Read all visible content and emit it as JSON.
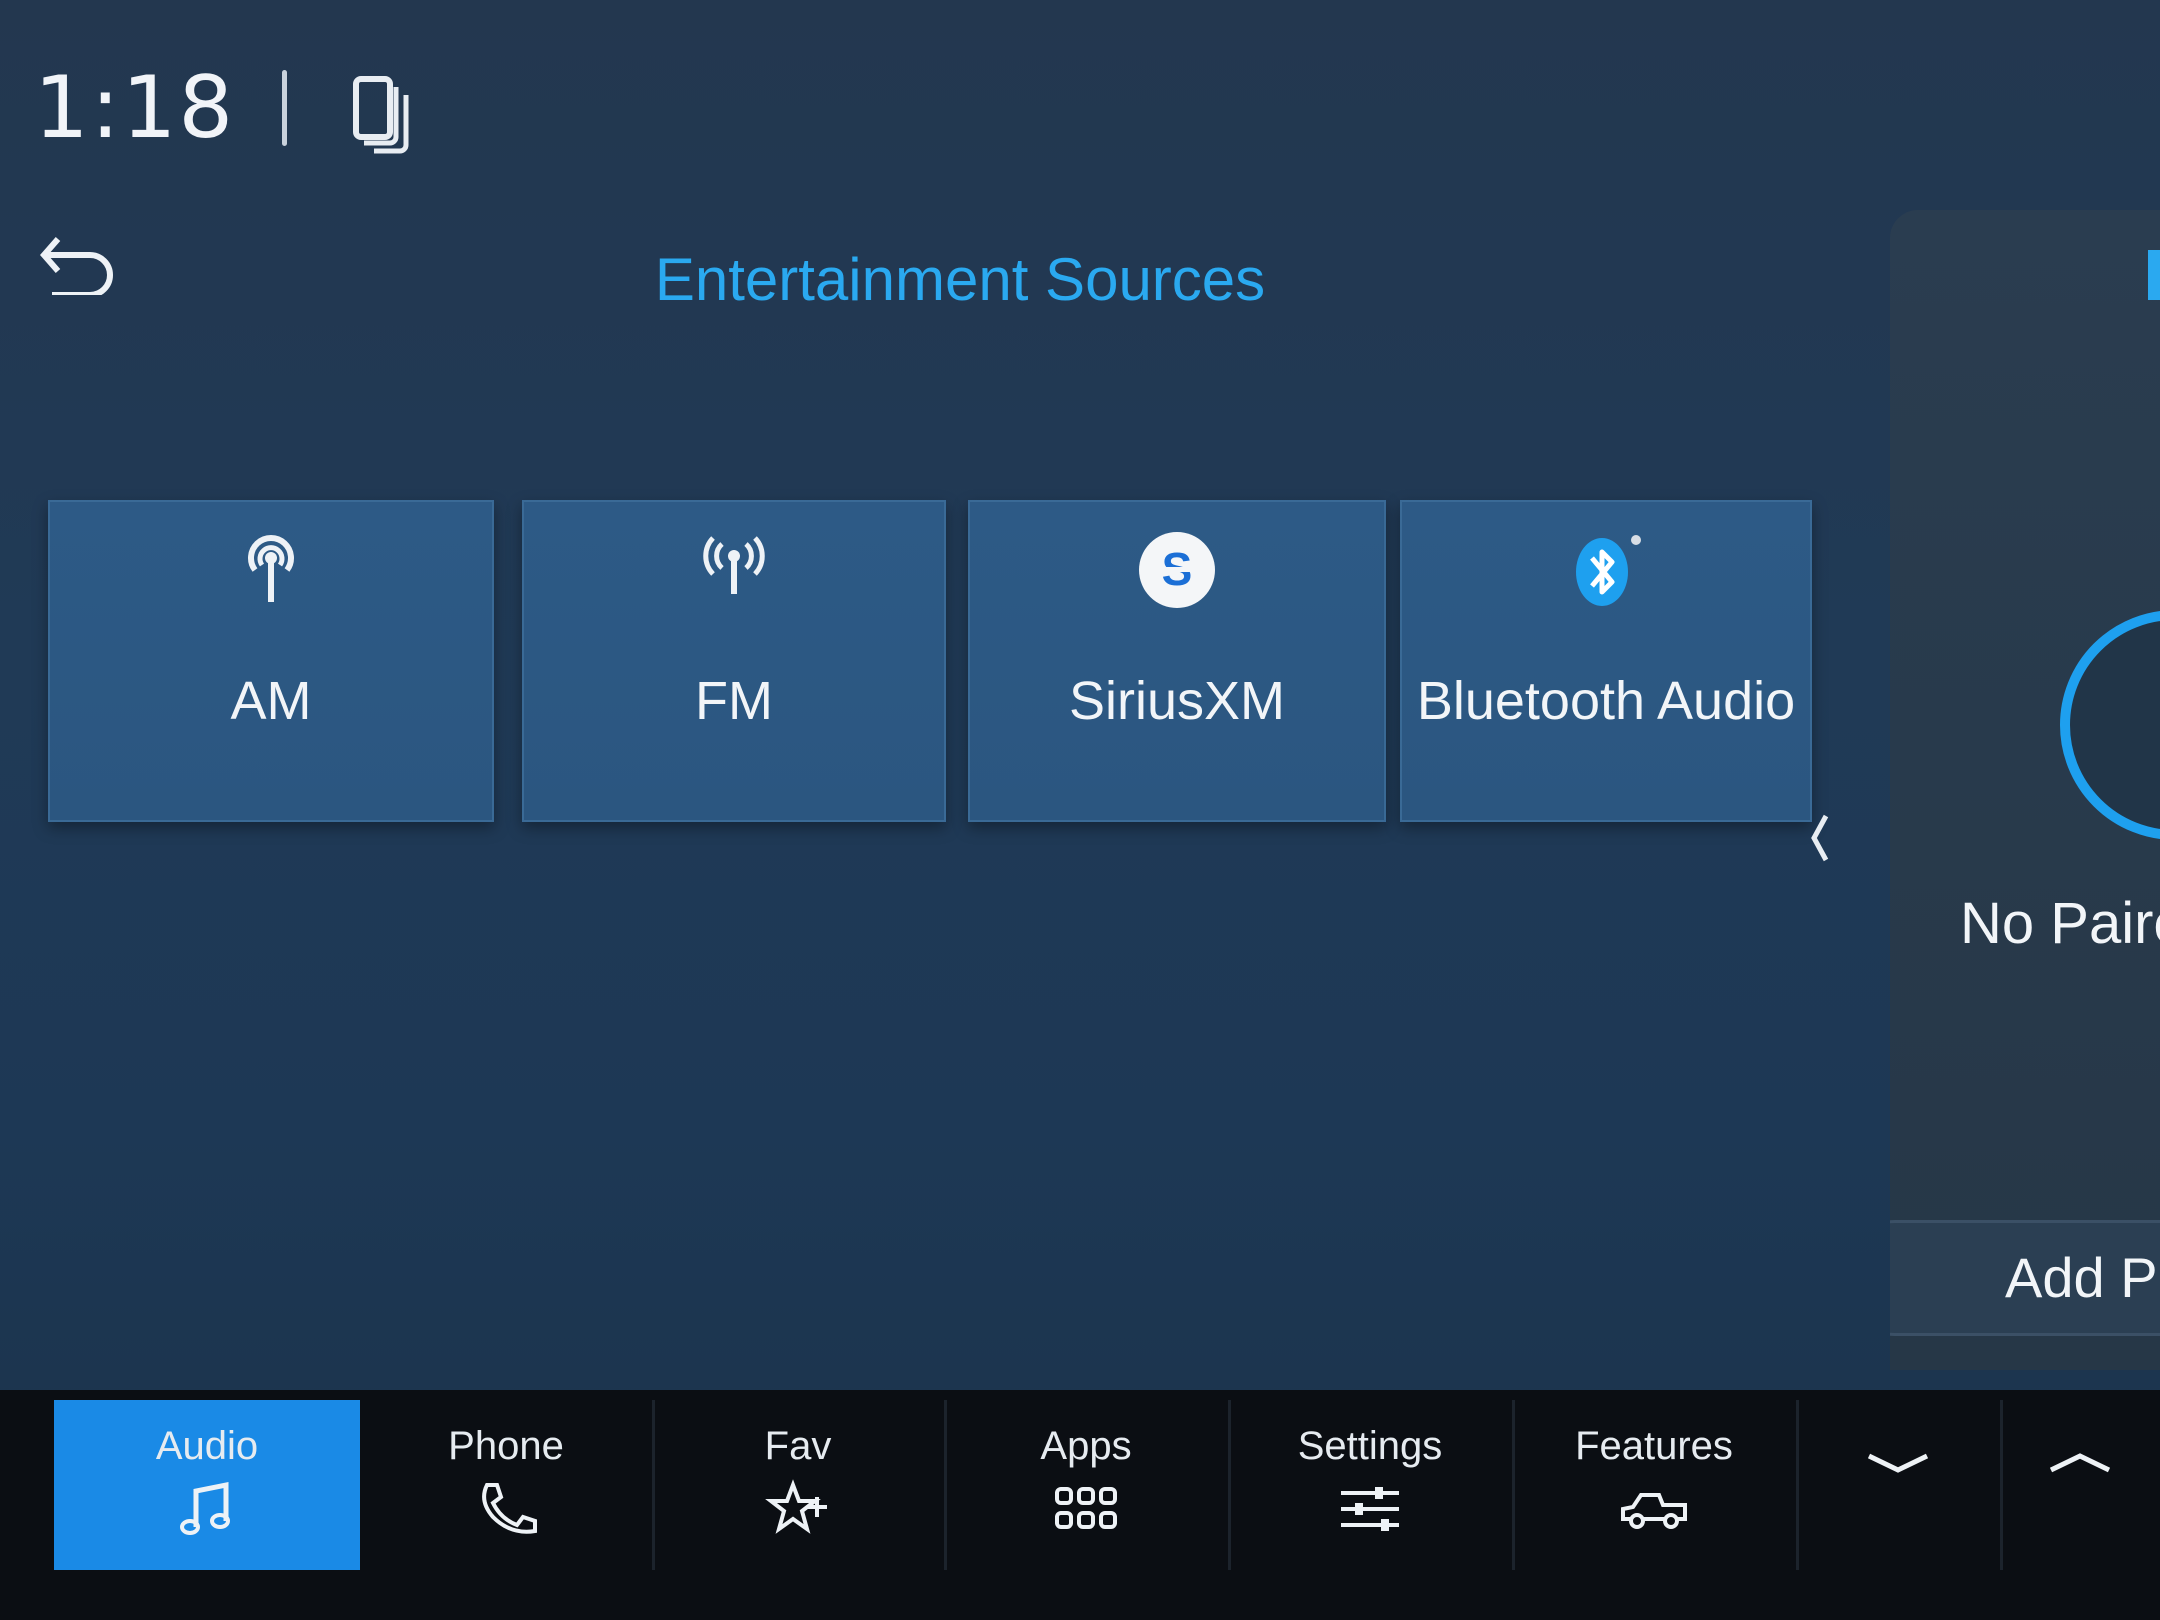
{
  "status_bar": {
    "time": "1:18",
    "icons": [
      "phone-projection-icon"
    ]
  },
  "header": {
    "back_icon": "back-arrow-icon",
    "title": "Entertainment Sources"
  },
  "sources": [
    {
      "label": "AM",
      "icon": "am-antenna-icon"
    },
    {
      "label": "FM",
      "icon": "fm-antenna-icon"
    },
    {
      "label": "SiriusXM",
      "icon": "siriusxm-icon"
    },
    {
      "label": "Bluetooth Audio",
      "icon": "bluetooth-icon"
    }
  ],
  "side_panel": {
    "status_text": "No Paire",
    "button_label": "Add Ph"
  },
  "nav": {
    "items": [
      {
        "label": "Audio",
        "icon": "music-note-icon",
        "active": true
      },
      {
        "label": "Phone",
        "icon": "phone-icon"
      },
      {
        "label": "Fav",
        "icon": "star-plus-icon"
      },
      {
        "label": "Apps",
        "icon": "apps-grid-icon"
      },
      {
        "label": "Settings",
        "icon": "sliders-icon"
      },
      {
        "label": "Features",
        "icon": "truck-icon"
      }
    ],
    "extra_icons": [
      "chevron-down-icon",
      "chevron-up-icon"
    ]
  },
  "colors": {
    "accent": "#1a8ae6",
    "title": "#2aa9f0",
    "tile": "#2d5a86",
    "background": "#203a56",
    "navbar": "#0b0e13"
  }
}
